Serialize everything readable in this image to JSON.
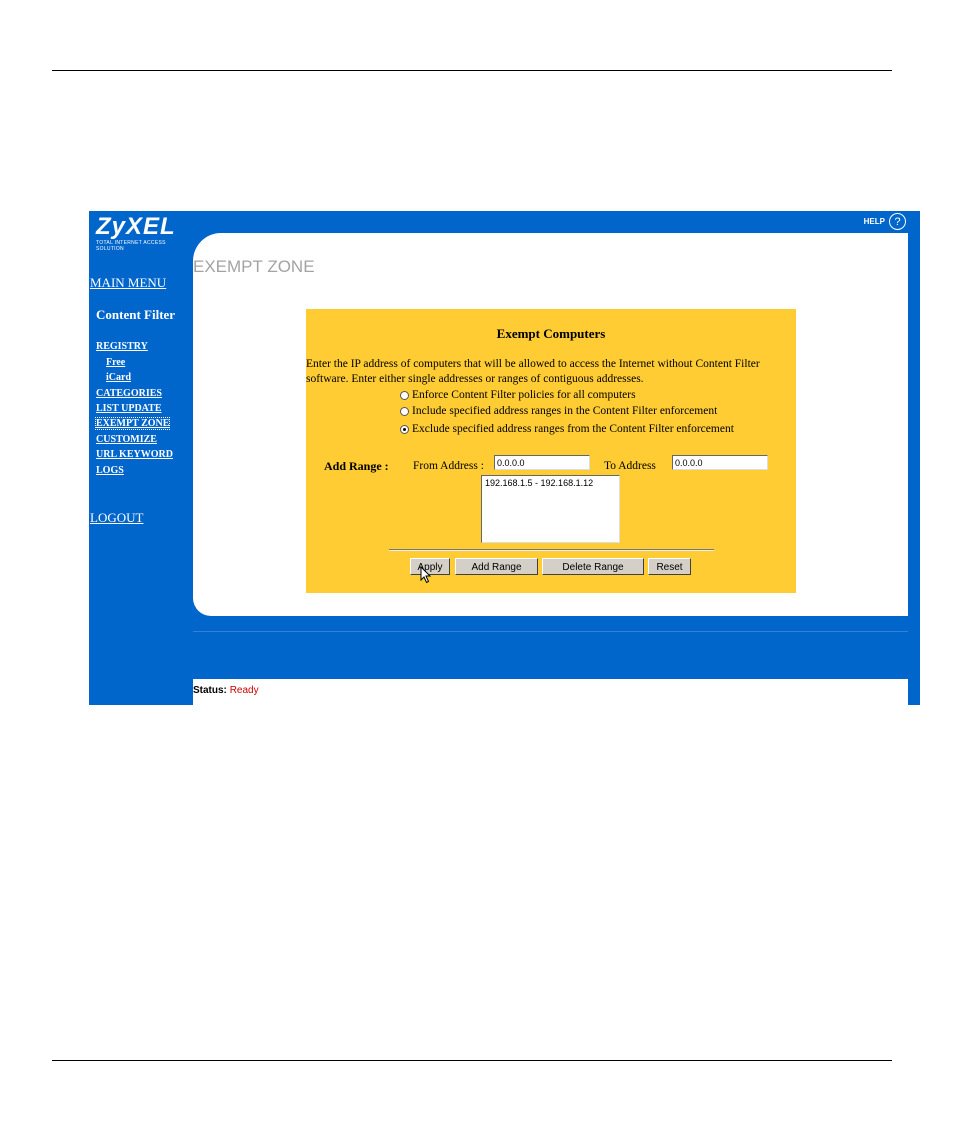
{
  "brand": {
    "logo": "ZyXEL",
    "tagline": "TOTAL INTERNET ACCESS SOLUTION"
  },
  "help": {
    "label": "HELP",
    "icon": "?"
  },
  "sidebar": {
    "main_menu": "MAIN MENU",
    "section_title": "Content Filter",
    "items": [
      {
        "label": "REGISTRY"
      },
      {
        "label": "Free"
      },
      {
        "label": "iCard"
      },
      {
        "label": "CATEGORIES"
      },
      {
        "label": "LIST UPDATE"
      },
      {
        "label": "EXEMPT ZONE"
      },
      {
        "label": "CUSTOMIZE"
      },
      {
        "label": "URL KEYWORD"
      },
      {
        "label": "LOGS"
      }
    ],
    "logout": "LOGOUT"
  },
  "page": {
    "title": "EXEMPT ZONE"
  },
  "panel": {
    "title": "Exempt Computers",
    "description": "Enter the IP address of computers that will be allowed to access the Internet without Content Filter software. Enter either single addresses or ranges of contiguous addresses.",
    "options": [
      {
        "label": "Enforce Content Filter policies for all computers",
        "selected": false
      },
      {
        "label": "Include specified address ranges in the Content Filter enforcement",
        "selected": false
      },
      {
        "label": "Exclude specified address ranges from the Content Filter enforcement",
        "selected": true
      }
    ],
    "add_range_label": "Add Range :",
    "from_label": "From Address :",
    "from_value": "0.0.0.0",
    "to_label": "To Address",
    "to_value": "0.0.0.0",
    "ranges": [
      "192.168.1.5 - 192.168.1.12"
    ],
    "buttons": {
      "apply": "Apply",
      "add_range": "Add Range",
      "delete_range": "Delete Range",
      "reset": "Reset"
    }
  },
  "status": {
    "label": "Status:",
    "value": "Ready"
  },
  "colors": {
    "frame_blue": "#0066cc",
    "panel_yellow": "#ffcc33",
    "status_red": "#cc0000",
    "title_gray": "#a3a3a3"
  }
}
